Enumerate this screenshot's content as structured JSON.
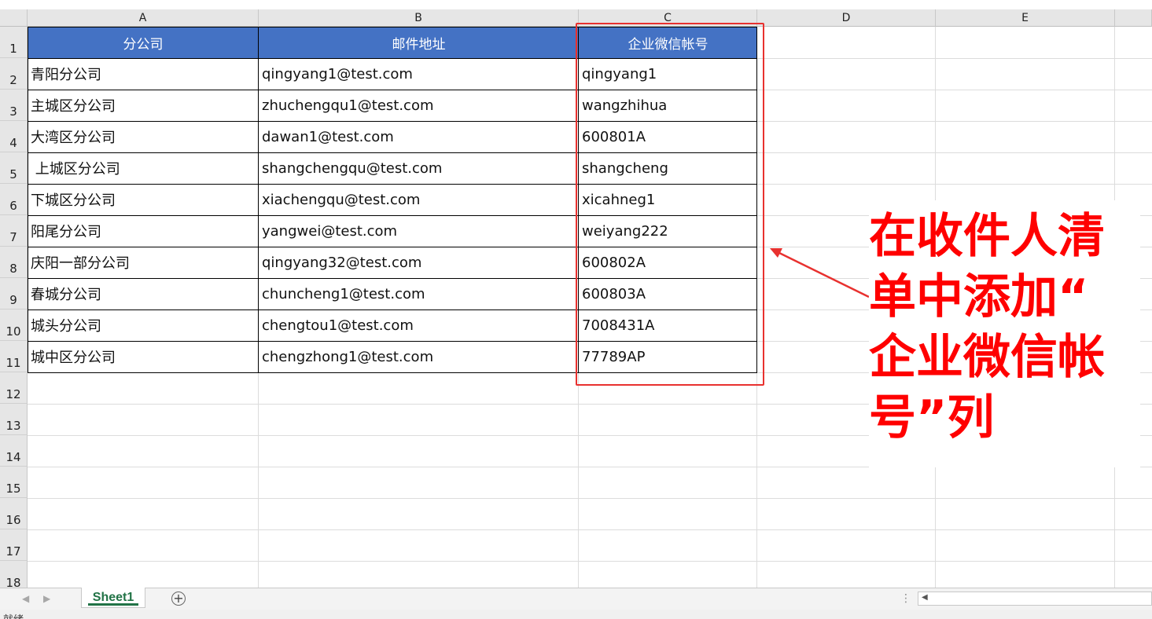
{
  "columns": [
    "A",
    "B",
    "C",
    "D",
    "E"
  ],
  "rows": [
    "1",
    "2",
    "3",
    "4",
    "5",
    "6",
    "7",
    "8",
    "9",
    "10",
    "11",
    "12",
    "13",
    "14",
    "15",
    "16",
    "17",
    "18"
  ],
  "table": {
    "headers": [
      "分公司",
      "邮件地址",
      "企业微信帐号"
    ],
    "rows": [
      [
        "青阳分公司",
        "qingyang1@test.com",
        "qingyang1"
      ],
      [
        "主城区分公司",
        "zhuchengqu1@test.com",
        "wangzhihua"
      ],
      [
        "大湾区分公司",
        "dawan1@test.com",
        "600801A"
      ],
      [
        " 上城区分公司",
        "shangchengqu@test.com",
        "shangcheng"
      ],
      [
        "下城区分公司",
        "xiachengqu@test.com",
        "xicahneg1"
      ],
      [
        "阳尾分公司",
        "yangwei@test.com",
        "weiyang222"
      ],
      [
        "庆阳一部分公司",
        "qingyang32@test.com",
        "600802A"
      ],
      [
        "春城分公司",
        "chuncheng1@test.com",
        "600803A"
      ],
      [
        "城头分公司",
        "chengtou1@test.com",
        "7008431A"
      ],
      [
        "城中区分公司",
        "chengzhong1@test.com",
        "77789AP"
      ]
    ]
  },
  "annotation": {
    "line1": "在收件人清",
    "line2": "单中添加“",
    "line3": "企业微信帐",
    "line4": "号”列"
  },
  "sheet_tab": "Sheet1",
  "add_sheet_symbol": "+",
  "status": "就绪",
  "colors": {
    "header_fill": "#4472c4",
    "highlight": "#e8312f",
    "annotation": "#ff0000",
    "tab": "#217346"
  }
}
